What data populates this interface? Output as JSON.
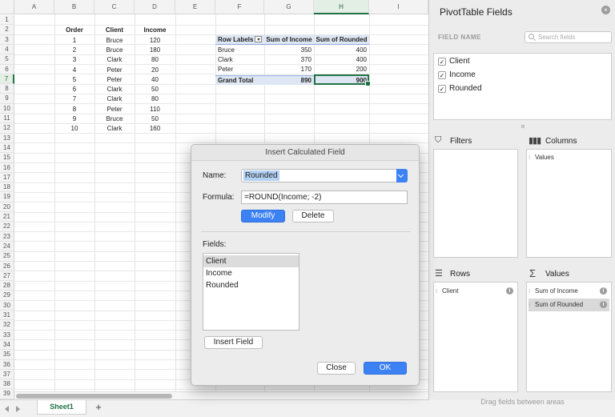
{
  "sheet": {
    "columns": [
      "A",
      "B",
      "C",
      "D",
      "E",
      "F",
      "G",
      "H",
      "I"
    ],
    "selected_column": "H",
    "rows": [
      "1",
      "2",
      "3",
      "4",
      "5",
      "6",
      "7",
      "8",
      "9",
      "10",
      "11",
      "12",
      "13",
      "14",
      "15",
      "16",
      "17",
      "18",
      "19",
      "20",
      "21",
      "22",
      "23",
      "24",
      "25",
      "26",
      "27",
      "28",
      "29",
      "30",
      "31",
      "32",
      "33",
      "34",
      "35",
      "36",
      "37",
      "38",
      "39"
    ],
    "selected_row": "7",
    "table_headers": [
      "Order",
      "Client",
      "Income"
    ],
    "table_rows": [
      [
        "1",
        "Bruce",
        "120"
      ],
      [
        "2",
        "Bruce",
        "180"
      ],
      [
        "3",
        "Clark",
        "80"
      ],
      [
        "4",
        "Peter",
        "20"
      ],
      [
        "5",
        "Peter",
        "40"
      ],
      [
        "6",
        "Clark",
        "50"
      ],
      [
        "7",
        "Clark",
        "80"
      ],
      [
        "8",
        "Peter",
        "110"
      ],
      [
        "9",
        "Bruce",
        "50"
      ],
      [
        "10",
        "Clark",
        "160"
      ]
    ],
    "pivot": {
      "headers": [
        "Row Labels",
        "Sum of Income",
        "Sum of Rounded"
      ],
      "rows": [
        [
          "Bruce",
          "350",
          "400"
        ],
        [
          "Clark",
          "370",
          "400"
        ],
        [
          "Peter",
          "170",
          "200"
        ]
      ],
      "total": [
        "Grand Total",
        "890",
        "900"
      ]
    },
    "tab_name": "Sheet1",
    "add_sheet": "+"
  },
  "panel": {
    "title": "PivotTable Fields",
    "close": "×",
    "field_name_label": "FIELD NAME",
    "search_placeholder": "Search fields",
    "fields": [
      {
        "label": "Client",
        "checked": true
      },
      {
        "label": "Income",
        "checked": true
      },
      {
        "label": "Rounded",
        "checked": true
      }
    ],
    "filters_label": "Filters",
    "columns_label": "Columns",
    "columns_items": [
      "Values"
    ],
    "rows_label": "Rows",
    "rows_items": [
      "Client"
    ],
    "values_label": "Values",
    "values_items": [
      "Sum of Income",
      "Sum of Rounded"
    ],
    "drag_hint": "Drag fields between areas"
  },
  "dialog": {
    "title": "Insert Calculated Field",
    "name_label": "Name:",
    "name_value": "Rounded",
    "formula_label": "Formula:",
    "formula_value": "=ROUND(Income; -2)",
    "modify_label": "Modify",
    "delete_label": "Delete",
    "fields_label": "Fields:",
    "fields": [
      "Client",
      "Income",
      "Rounded"
    ],
    "insert_field_label": "Insert Field",
    "close_label": "Close",
    "ok_label": "OK"
  }
}
